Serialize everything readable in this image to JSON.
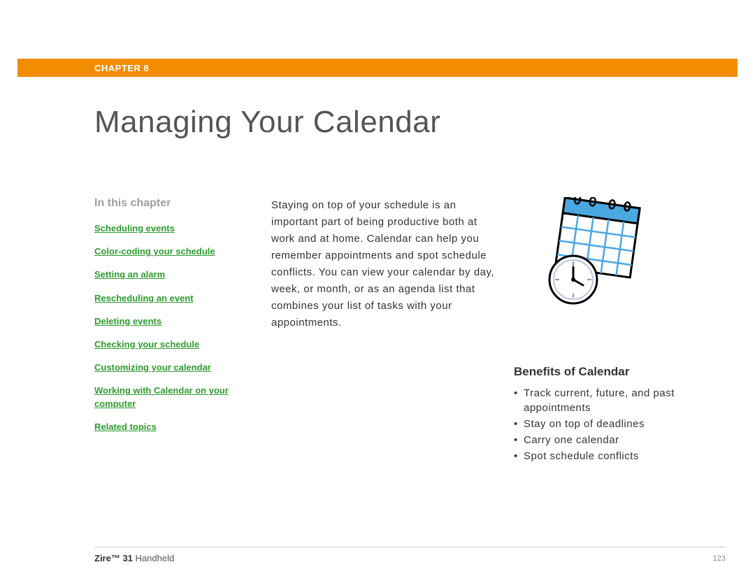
{
  "chapter_label": "CHAPTER 8",
  "page_title": "Managing Your Calendar",
  "sidebar": {
    "heading": "In this chapter",
    "links": [
      "Scheduling events",
      "Color-coding your schedule",
      "Setting an alarm",
      "Rescheduling an event",
      "Deleting events",
      "Checking your schedule",
      "Customizing your calendar",
      "Working with Calendar on your computer",
      "Related topics"
    ]
  },
  "main_paragraph": "Staying on top of your schedule is an important part of being productive both at work and at home. Calendar can help you remember appointments and spot schedule conflicts. You can view your calendar by day, week, or month, or as an agenda list that combines your list of tasks with your appointments.",
  "benefits": {
    "heading": "Benefits of Calendar",
    "items": [
      "Track current, future, and past appointments",
      "Stay on top of deadlines",
      "Carry one calendar",
      "Spot schedule conflicts"
    ]
  },
  "footer": {
    "product_bold": "Zire™ 31",
    "product_rest": " Handheld",
    "page_number": "123"
  }
}
